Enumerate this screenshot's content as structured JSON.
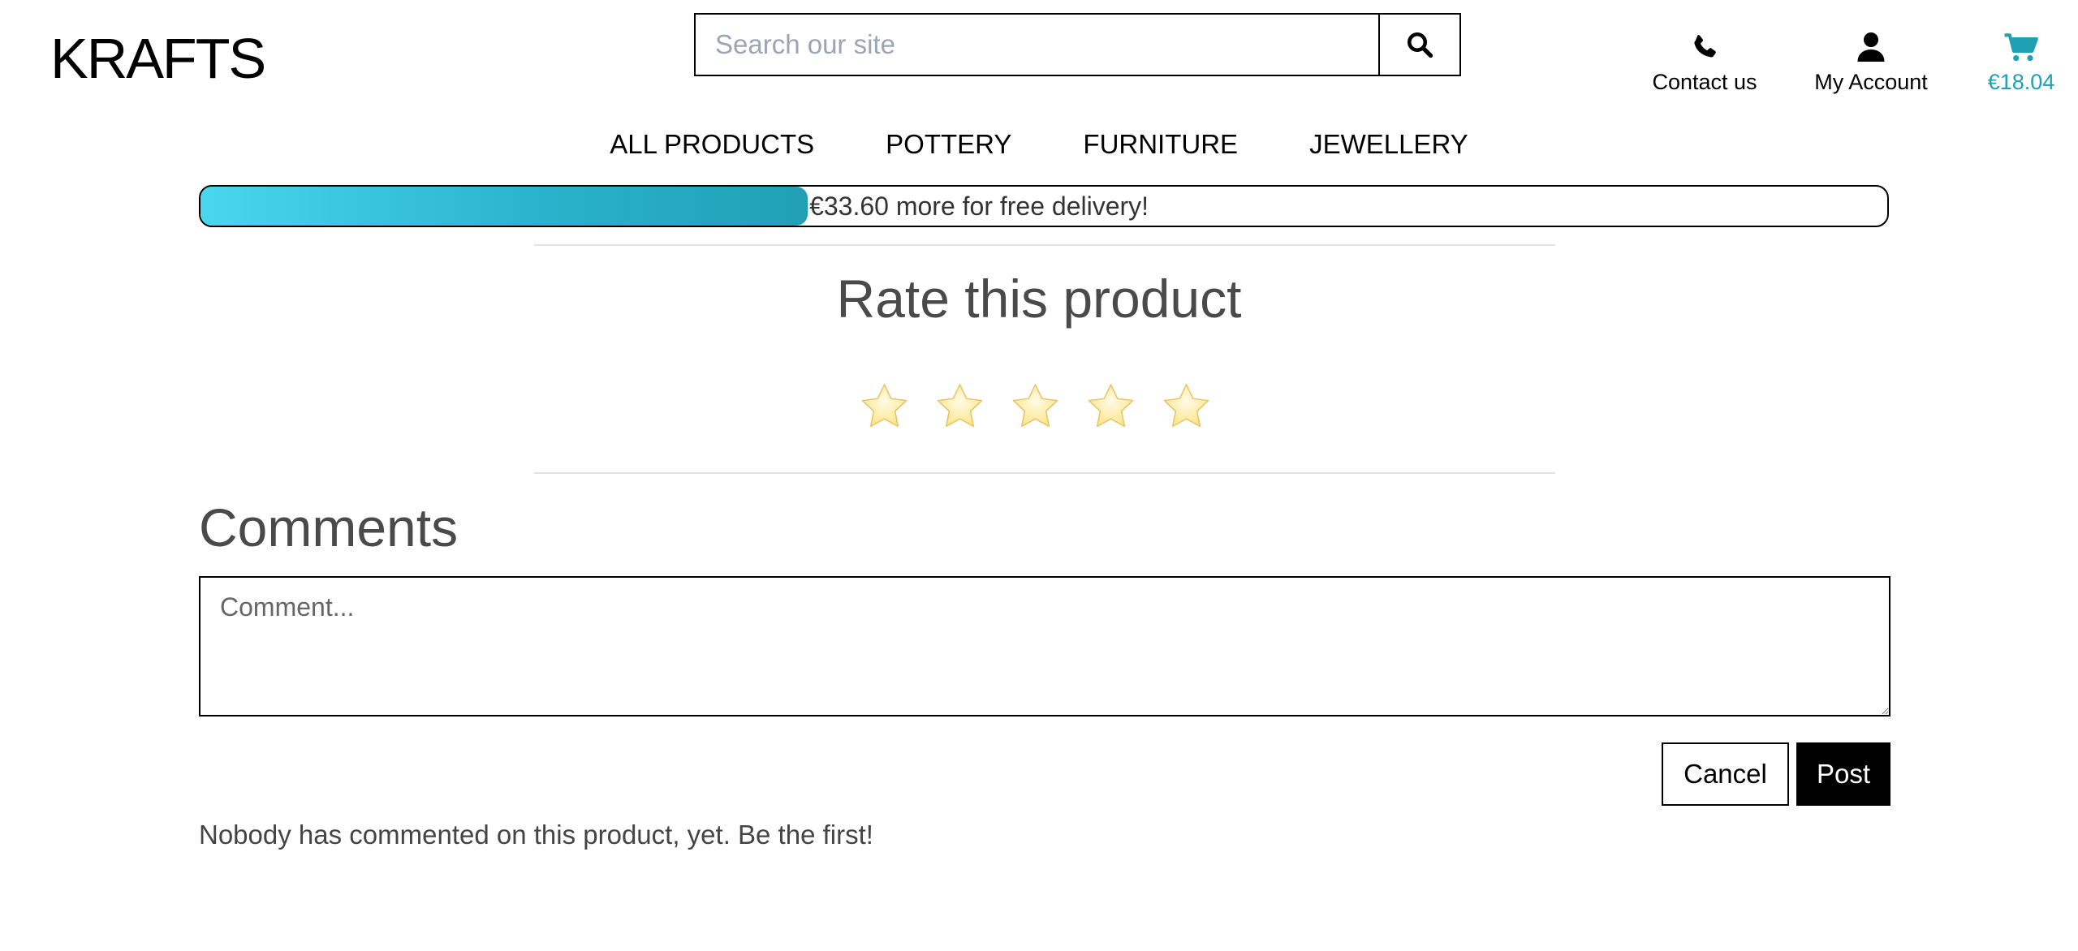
{
  "brand": {
    "logo_text": "KRAFTS"
  },
  "search": {
    "placeholder": "Search our site",
    "button_icon": "search-icon"
  },
  "header_links": {
    "contact": {
      "label": "Contact us",
      "icon": "phone-icon"
    },
    "account": {
      "label": "My Account",
      "icon": "user-icon"
    },
    "cart": {
      "label": "€18.04",
      "icon": "cart-icon"
    }
  },
  "nav": {
    "items": [
      {
        "label": "ALL PRODUCTS"
      },
      {
        "label": "POTTERY"
      },
      {
        "label": "FURNITURE"
      },
      {
        "label": "JEWELLERY"
      }
    ]
  },
  "delivery_progress": {
    "message": "€33.60 more for free delivery!",
    "fraction": 0.36
  },
  "rating": {
    "title": "Rate this product",
    "max_stars": 5,
    "selected": 0
  },
  "comments": {
    "title": "Comments",
    "placeholder": "Comment...",
    "cancel_label": "Cancel",
    "post_label": "Post",
    "empty_message": "Nobody has commented on this product, yet. Be the first!"
  },
  "colors": {
    "accent": "#1fa0b5",
    "progress_start": "#49d6ee",
    "progress_end": "#21a0b5",
    "star": "#fde68a",
    "text_dark": "#4a4a4a"
  }
}
